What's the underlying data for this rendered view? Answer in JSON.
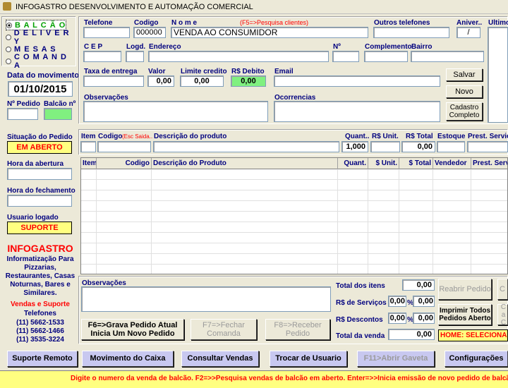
{
  "window": {
    "title": "INFOGASTRO DESENVOLVIMENTO E AUTOMAÇÃO COMERCIAL"
  },
  "modes": [
    {
      "label": "B A L C Ã O",
      "selected": true
    },
    {
      "label": "D E L I V E R Y",
      "selected": false
    },
    {
      "label": "M E S A S",
      "selected": false
    },
    {
      "label": "C O M A N D A",
      "selected": false
    }
  ],
  "movement": {
    "label": "Data do movimento",
    "date": "01/10/2015"
  },
  "order": {
    "pedido_label": "Nº Pedido",
    "balcao_label": "Balcão nº"
  },
  "client": {
    "telefone_label": "Telefone",
    "codigo_label": "Codigo",
    "codigo_value": "000000",
    "nome_label": "N o m e",
    "nome_hint": "(F5=>Pesquisa clientes)",
    "nome_value": "VENDA AO CONSUMIDOR",
    "outros_label": "Outros telefones",
    "aniver_label": "Aniver..",
    "aniver_value": "/",
    "ultimo_label": "Ultimo",
    "cep_label": "C E P",
    "logd_label": "Logd.",
    "endereco_label": "Endereço",
    "numero_label": "Nº",
    "complemento_label": "Complemento",
    "bairro_label": "Bairro",
    "taxa_label": "Taxa de entrega",
    "valor_label": "Valor",
    "valor_value": "0,00",
    "limite_label": "Limite credito",
    "limite_value": "0,00",
    "debito_label": "R$ Debito",
    "debito_value": "0,00",
    "email_label": "Email",
    "obs_label": "Observações",
    "ocorr_label": "Ocorrencias"
  },
  "client_buttons": {
    "salvar": "Salvar",
    "novo": "Novo",
    "cadastro": "Cadastro Completo"
  },
  "status": {
    "situacao_label": "Situação do Pedido",
    "situacao_value": "EM ABERTO",
    "hora_abertura_label": "Hora da abertura",
    "hora_fechamento_label": "Hora do fechamento",
    "usuario_label": "Usuario logado",
    "usuario_value": "SUPORTE"
  },
  "brand": {
    "name": "INFOGASTRO",
    "tagline": "Informatização Para Pizzarias, Restaurantes, Casas Noturnas, Bares e Similares.",
    "vendas": "Vendas e Suporte",
    "telefones": "Telefones",
    "phones": [
      "(11) 5662-1533",
      "(11) 5662-1466",
      "(11) 3535-3224"
    ]
  },
  "item_entry": {
    "item_label": "Item",
    "codigo_label": "Codigo",
    "codigo_hint": "(Esc Saida..",
    "descricao_label": "Descrição do produto",
    "quant_label": "Quant..",
    "quant_value": "1,000",
    "unit_label": "R$ Unit.",
    "total_label": "R$ Total",
    "total_value": "0,00",
    "estoque_label": "Estoque",
    "prest_label": "Prest. Serviç"
  },
  "grid": {
    "columns": [
      "Item",
      "Codigo",
      "Descrição do Produto",
      "Quant.",
      "$ Unit.",
      "$ Total",
      "Vendedor",
      "Prest. Serv"
    ]
  },
  "footer_form": {
    "obs_label": "Observações",
    "total_itens_label": "Total  dos itens",
    "total_itens_value": "0,00",
    "servicos_label": "R$ de Serviços",
    "servicos_pct": "0,00",
    "servicos_value": "0,00",
    "descontos_label": "R$   Descontos",
    "descontos_pct": "0,00",
    "descontos_value": "0,00",
    "total_venda_label": "Total da venda",
    "total_venda_value": "0,00",
    "pct_sign": "%"
  },
  "action_buttons": {
    "f6": "F6=>Grava Pedido Atual Inicia Um Novo Pedido",
    "f7": "F7=>Fechar Comanda",
    "f8": "F8=>Receber Pedido",
    "reabrir": "Reabrir Pedido",
    "imprimir": "Imprimir Todos Pedidos Aberto",
    "cut1": "C",
    "cut2": "Ca C"
  },
  "home_banner": "HOME: SELECIONA TIP",
  "bottom_buttons": [
    "Suporte Remoto",
    "Movimento do Caixa",
    "Consultar Vendas",
    "Trocar de Usuario",
    "F11>Abrir Gaveta",
    "Configurações"
  ],
  "status_bar": "Digite o numero da venda de balcão.  F2=>>Pesquisa vendas de balcão em aberto.  Enter=>>Inicia emissão de novo pedido de balcão."
}
